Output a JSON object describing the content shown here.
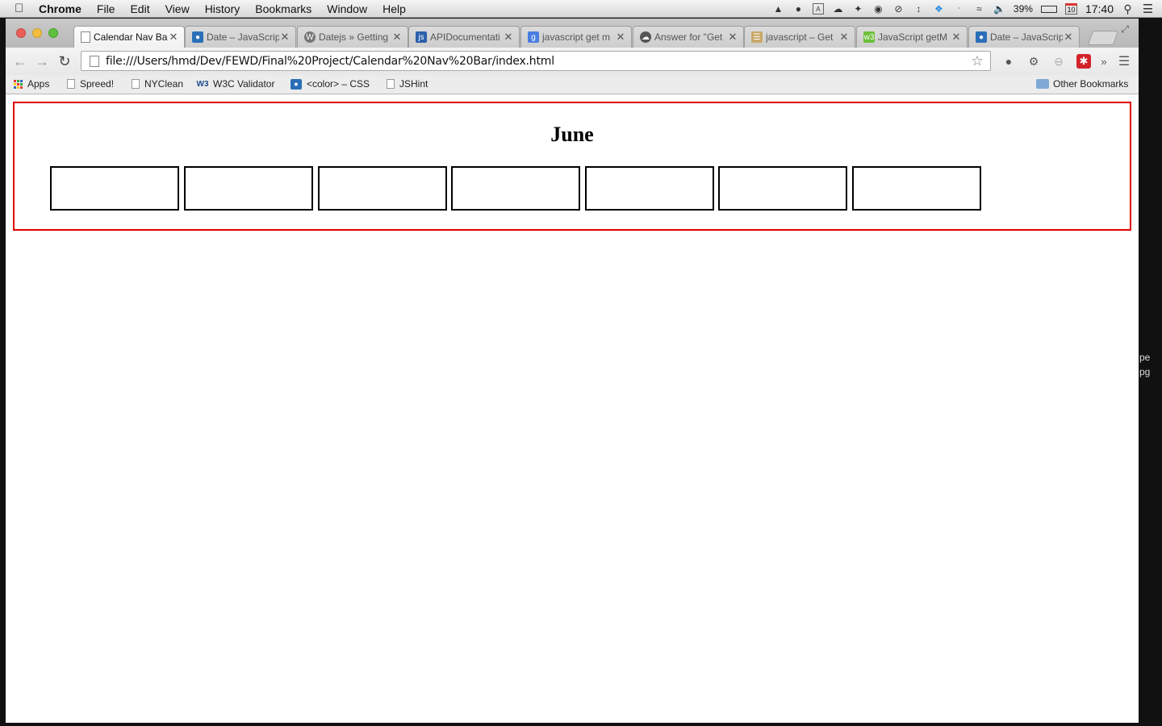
{
  "menubar": {
    "app_name": "Chrome",
    "menus": [
      "File",
      "Edit",
      "View",
      "History",
      "Bookmarks",
      "Window",
      "Help"
    ],
    "battery": "39%",
    "calendar_day": "10",
    "clock": "17:40"
  },
  "tabs": [
    {
      "title": "Calendar Nav Ba",
      "favicon": "page-icon",
      "fav_color": "#ffffff",
      "active": true
    },
    {
      "title": "Date – JavaScript",
      "favicon": "mdn-icon",
      "fav_color": "#2a6fb8",
      "active": false
    },
    {
      "title": "Datejs » Getting",
      "favicon": "wordpress-icon",
      "fav_color": "#777777",
      "active": false
    },
    {
      "title": "APIDocumentati",
      "favicon": "api-icon",
      "fav_color": "#2b5fab",
      "active": false
    },
    {
      "title": "javascript get m",
      "favicon": "google-icon",
      "fav_color": "#4a7de2",
      "active": false
    },
    {
      "title": "Answer for \"Get",
      "favicon": "cloud-icon",
      "fav_color": "#555555",
      "active": false
    },
    {
      "title": "javascript – Get",
      "favicon": "stackoverflow-icon",
      "fav_color": "#c8a96a",
      "active": false
    },
    {
      "title": "JavaScript getM",
      "favicon": "w3schools-icon",
      "fav_color": "#6bbf3a",
      "active": false
    },
    {
      "title": "Date – JavaScrip",
      "favicon": "mdn-icon",
      "fav_color": "#2a6fb8",
      "active": false
    }
  ],
  "address_bar": {
    "url": "file:///Users/hmd/Dev/FEWD/Final%20Project/Calendar%20Nav%20Bar/index.html"
  },
  "bookmarks": [
    {
      "label": "Apps",
      "icon": "apps-icon"
    },
    {
      "label": "Spreed!",
      "icon": "page-icon"
    },
    {
      "label": "NYClean",
      "icon": "page-icon"
    },
    {
      "label": "W3C Validator",
      "icon": "w3c-icon"
    },
    {
      "label": "<color> – CSS",
      "icon": "mdn-icon"
    },
    {
      "label": "JSHint",
      "icon": "page-icon"
    }
  ],
  "other_bookmarks": "Other Bookmarks",
  "desktop": {
    "label_line1": "pe",
    "label_line2": "pg"
  },
  "page": {
    "month": "June",
    "day_box_count": 7,
    "border_color": "#e00000"
  }
}
